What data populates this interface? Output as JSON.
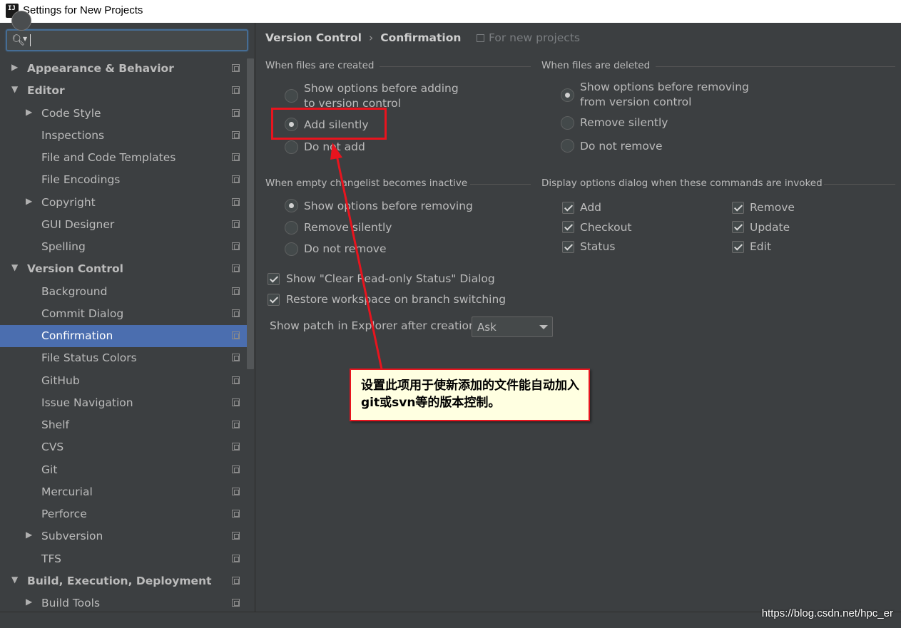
{
  "window": {
    "title": "Settings for New Projects",
    "icon": "intellij-idea-icon"
  },
  "search": {
    "placeholder": "",
    "icon": "search-icon"
  },
  "sidebar": {
    "items": [
      {
        "label": "Appearance & Behavior",
        "level": 0,
        "bold": true,
        "arrow": "▶"
      },
      {
        "label": "Editor",
        "level": 0,
        "bold": true,
        "arrow": "▼"
      },
      {
        "label": "Code Style",
        "level": 1,
        "arrow": "▶"
      },
      {
        "label": "Inspections",
        "level": 1
      },
      {
        "label": "File and Code Templates",
        "level": 1
      },
      {
        "label": "File Encodings",
        "level": 1
      },
      {
        "label": "Copyright",
        "level": 1,
        "arrow": "▶"
      },
      {
        "label": "GUI Designer",
        "level": 1
      },
      {
        "label": "Spelling",
        "level": 1
      },
      {
        "label": "Version Control",
        "level": 0,
        "bold": true,
        "arrow": "▼"
      },
      {
        "label": "Background",
        "level": 1
      },
      {
        "label": "Commit Dialog",
        "level": 1
      },
      {
        "label": "Confirmation",
        "level": 1,
        "selected": true
      },
      {
        "label": "File Status Colors",
        "level": 1
      },
      {
        "label": "GitHub",
        "level": 1
      },
      {
        "label": "Issue Navigation",
        "level": 1
      },
      {
        "label": "Shelf",
        "level": 1
      },
      {
        "label": "CVS",
        "level": 1
      },
      {
        "label": "Git",
        "level": 1
      },
      {
        "label": "Mercurial",
        "level": 1
      },
      {
        "label": "Perforce",
        "level": 1
      },
      {
        "label": "Subversion",
        "level": 1,
        "arrow": "▶"
      },
      {
        "label": "TFS",
        "level": 1
      },
      {
        "label": "Build, Execution, Deployment",
        "level": 0,
        "bold": true,
        "arrow": "▼"
      },
      {
        "label": "Build Tools",
        "level": 1,
        "arrow": "▶"
      }
    ]
  },
  "header": {
    "crumb1": "Version Control",
    "sep": "›",
    "crumb2": "Confirmation",
    "for_new_projects": "For new projects"
  },
  "sections": {
    "created": {
      "title": "When files are created",
      "opt1_line1": "Show options before adding",
      "opt1_line2": "to version control",
      "opt2": "Add silently",
      "opt3": "Do not add",
      "selected": 2
    },
    "deleted": {
      "title": "When files are deleted",
      "opt1_line1": "Show options before removing",
      "opt1_line2": "from version control",
      "opt2": "Remove silently",
      "opt3": "Do not remove",
      "selected": 1
    },
    "changelist": {
      "title": "When empty changelist becomes inactive",
      "opt1": "Show options before removing",
      "opt2": "Remove silently",
      "opt3": "Do not remove",
      "selected": 1
    },
    "commands": {
      "title": "Display options dialog when these commands are invoked",
      "add": "Add",
      "checkout": "Checkout",
      "status": "Status",
      "remove": "Remove",
      "update": "Update",
      "edit": "Edit"
    }
  },
  "misc": {
    "clear_readonly": "Show \"Clear Read-only Status\" Dialog",
    "restore_workspace": "Restore workspace on branch switching",
    "show_patch_label": "Show patch in Explorer after creation:",
    "show_patch_value": "Ask"
  },
  "annotation": {
    "callout_text": "设置此项用于使新添加的文件能自动加入git或svn等的版本控制。",
    "color": "#e8141e"
  },
  "watermark": "https://blog.csdn.net/hpc_er"
}
